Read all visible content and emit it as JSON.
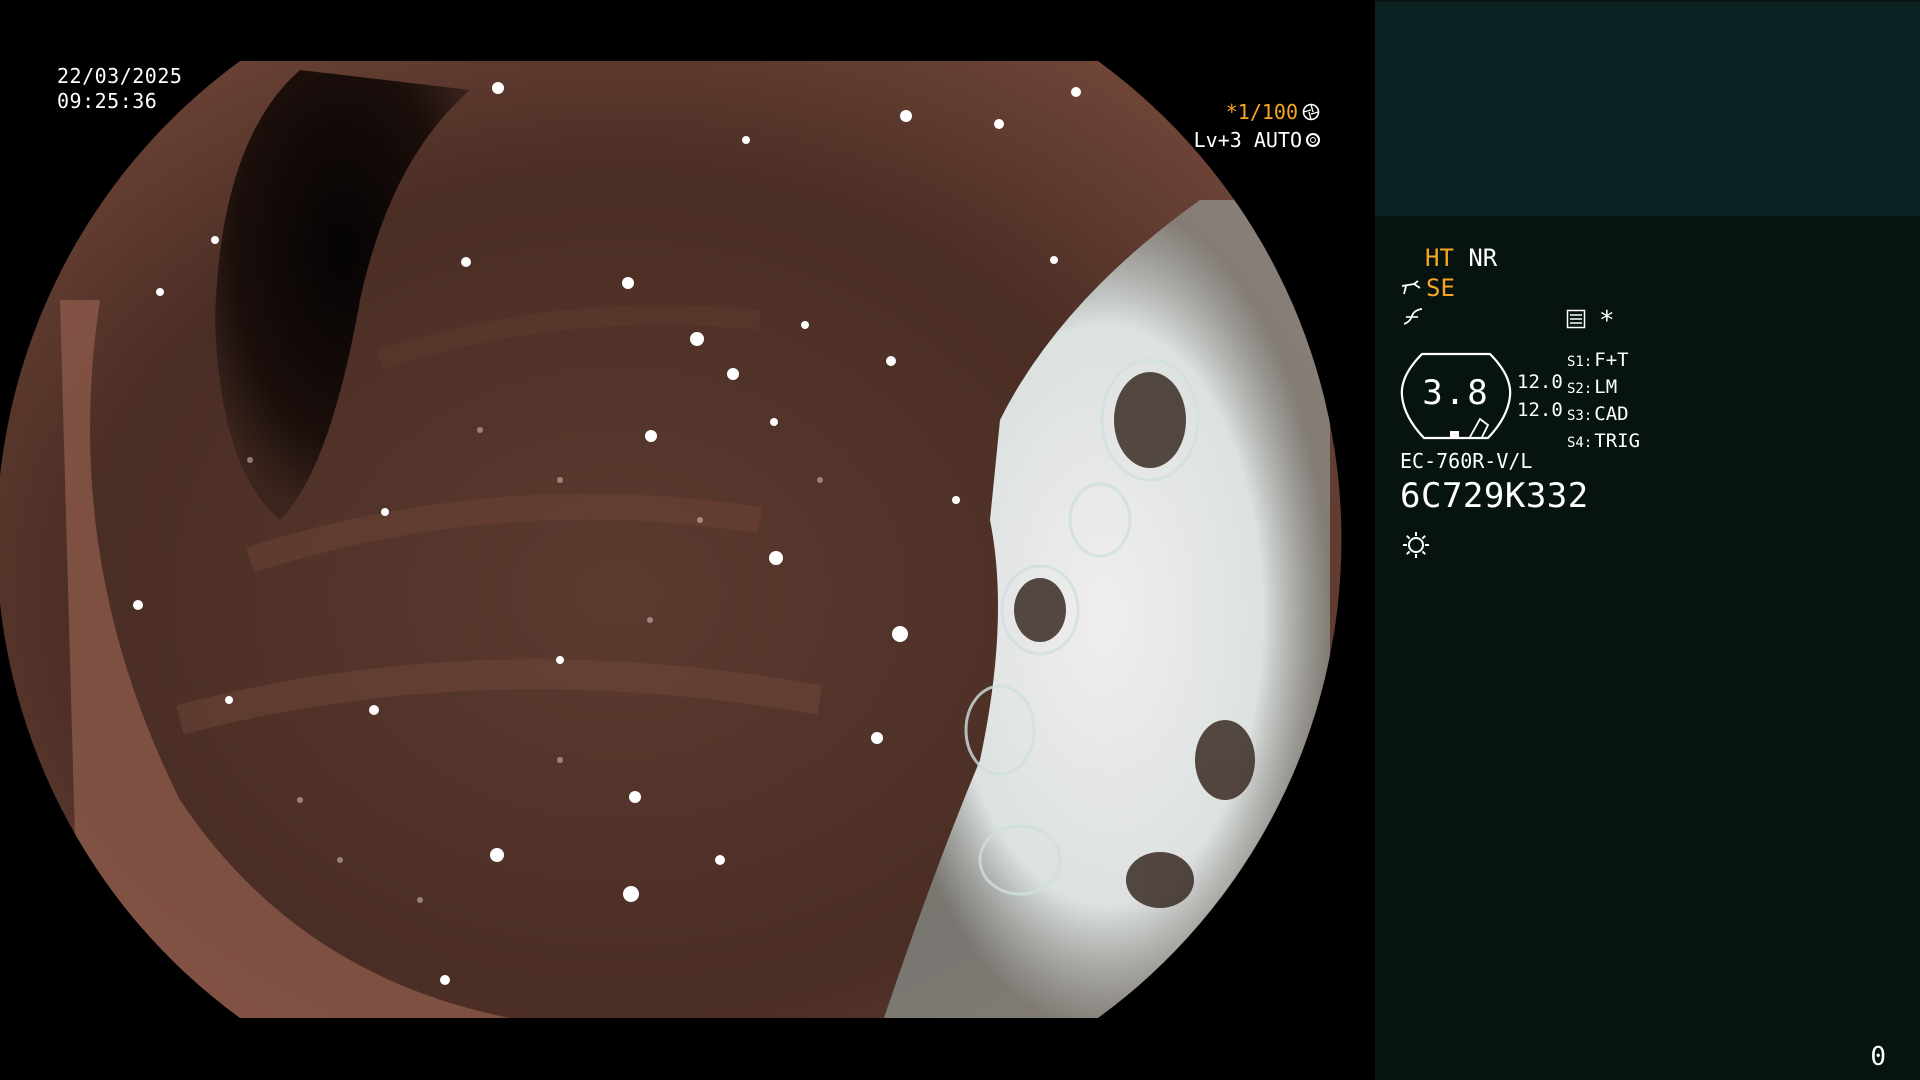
{
  "overlay": {
    "date": "22/03/2025",
    "time": "09:25:36",
    "shutter_speed": "*1/100",
    "iris_level": "Lv+3 AUTO"
  },
  "status": {
    "ht": "HT",
    "nr": "NR",
    "se": "SE",
    "asterisk": "*"
  },
  "gauge": {
    "value": "3.8",
    "aux_top": "12.0",
    "aux_bottom": "12.0"
  },
  "switches": [
    {
      "key": "S1:",
      "value": "F+T"
    },
    {
      "key": "S2:",
      "value": "LM"
    },
    {
      "key": "S3:",
      "value": "CAD"
    },
    {
      "key": "S4:",
      "value": "TRIG"
    }
  ],
  "scope": {
    "model": "EC-760R-V/L",
    "serial": "6C729K332"
  },
  "counter": "0",
  "colors": {
    "accent_orange": "#f5a623",
    "panel_bg": "#071310",
    "panel_top_bg": "#0c2222",
    "text": "#ffffff"
  },
  "icons": [
    "aperture-icon",
    "iris-ring-icon",
    "scope-tip-icon",
    "tone-curve-icon",
    "menu-list-icon",
    "brightness-icon"
  ]
}
